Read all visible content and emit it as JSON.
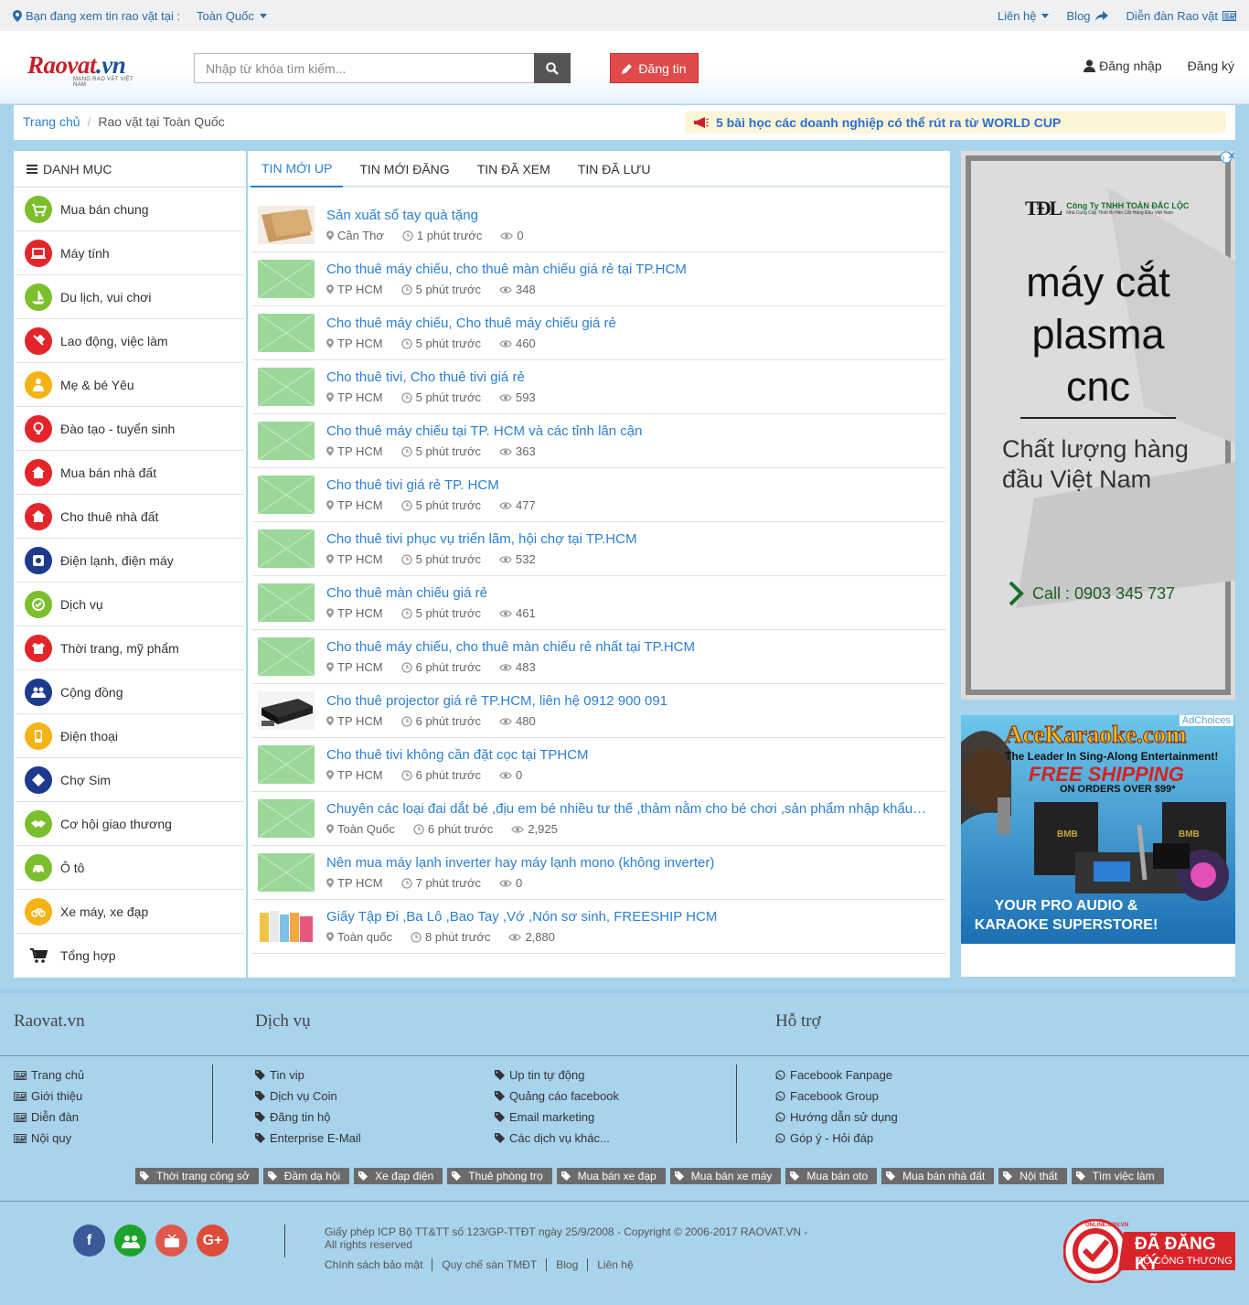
{
  "topbar": {
    "viewing_label": "Bạn đang xem tin rao vặt tại :",
    "region": "Toàn Quốc",
    "links": [
      "Liên hệ",
      "Blog",
      "Diễn đàn Rao vặt"
    ]
  },
  "header": {
    "logo_text": "Raovat",
    "logo_domain": ".vn",
    "logo_tagline": "MẠNG RAO VẶT VIỆT NAM",
    "search_placeholder": "Nhập từ khóa tìm kiếm...",
    "post_button": "Đăng tin",
    "login": "Đăng nhập",
    "register": "Đăng ký"
  },
  "breadcrumb": {
    "home": "Trang chủ",
    "current": "Rao vặt tại Toàn Quốc",
    "announcement": "5 bài học các doanh nghiệp có thể rút ra từ WORLD CUP"
  },
  "sidebar": {
    "title": "DANH MỤC",
    "items": [
      {
        "label": "Mua bán chung",
        "icon": "cart-icon",
        "color": "#7cbf2c"
      },
      {
        "label": "Máy tính",
        "icon": "laptop-icon",
        "color": "#e3252b"
      },
      {
        "label": "Du lịch, vui chơi",
        "icon": "sailboat-icon",
        "color": "#7cbf2c"
      },
      {
        "label": "Lao động, việc làm",
        "icon": "tools-icon",
        "color": "#e3252b"
      },
      {
        "label": "Mẹ & bé Yêu",
        "icon": "baby-icon",
        "color": "#f5b316"
      },
      {
        "label": "Đào tạo - tuyển sinh",
        "icon": "lightbulb-icon",
        "color": "#e3252b"
      },
      {
        "label": "Mua bán nhà đất",
        "icon": "house-icon",
        "color": "#e3252b"
      },
      {
        "label": "Cho thuê nhà đất",
        "icon": "house-icon",
        "color": "#e3252b"
      },
      {
        "label": "Điện lạnh, điện máy",
        "icon": "washer-icon",
        "color": "#1e3a8f"
      },
      {
        "label": "Dịch vụ",
        "icon": "service-icon",
        "color": "#7cbf2c"
      },
      {
        "label": "Thời trang, mỹ phẩm",
        "icon": "shirt-icon",
        "color": "#e3252b"
      },
      {
        "label": "Cộng đồng",
        "icon": "people-icon",
        "color": "#1e3a8f"
      },
      {
        "label": "Điện thoại",
        "icon": "phone-icon",
        "color": "#f5b316"
      },
      {
        "label": "Chợ Sim",
        "icon": "sim-icon",
        "color": "#1e3a8f"
      },
      {
        "label": "Cơ hội giao thương",
        "icon": "handshake-icon",
        "color": "#7cbf2c"
      },
      {
        "label": "Ô tô",
        "icon": "car-icon",
        "color": "#7cbf2c"
      },
      {
        "label": "Xe máy, xe đạp",
        "icon": "bicycle-icon",
        "color": "#f5b316"
      },
      {
        "label": "Tổng hợp",
        "icon": "shopping-cart-icon",
        "color": "#222222"
      }
    ]
  },
  "tabs": [
    "TIN MỚI UP",
    "TIN MỚI ĐĂNG",
    "TIN ĐÃ XEM",
    "TIN ĐÃ LƯU"
  ],
  "listings": [
    {
      "title": "Sản xuất sổ tay quà tặng",
      "location": "Cần Thơ",
      "time": "1 phút trước",
      "views": "0",
      "thumb": "notebook"
    },
    {
      "title": "Cho thuê máy chiếu, cho thuê màn chiếu giá rẻ tại TP.HCM",
      "location": "TP HCM",
      "time": "5 phút trước",
      "views": "348",
      "thumb": "placeholder"
    },
    {
      "title": "Cho thuê máy chiếu, Cho thuê máy chiếu giá rẻ",
      "location": "TP HCM",
      "time": "5 phút trước",
      "views": "460",
      "thumb": "placeholder"
    },
    {
      "title": "Cho thuê tivi, Cho thuê tivi giá rẻ",
      "location": "TP HCM",
      "time": "5 phút trước",
      "views": "593",
      "thumb": "placeholder"
    },
    {
      "title": "Cho thuê máy chiếu tại TP. HCM và các tỉnh lân cận",
      "location": "TP HCM",
      "time": "5 phút trước",
      "views": "363",
      "thumb": "placeholder"
    },
    {
      "title": "Cho thuê tivi giá rẻ TP. HCM",
      "location": "TP HCM",
      "time": "5 phút trước",
      "views": "477",
      "thumb": "placeholder"
    },
    {
      "title": "Cho thuê tivi phục vụ triển lãm, hội chợ tại TP.HCM",
      "location": "TP HCM",
      "time": "5 phút trước",
      "views": "532",
      "thumb": "placeholder"
    },
    {
      "title": "Cho thuê màn chiếu giá rẻ",
      "location": "TP HCM",
      "time": "5 phút trước",
      "views": "461",
      "thumb": "placeholder"
    },
    {
      "title": "Cho thuê máy chiếu, cho thuê màn chiếu rẻ nhất tại TP.HCM",
      "location": "TP HCM",
      "time": "6 phút trước",
      "views": "483",
      "thumb": "placeholder"
    },
    {
      "title": "Cho thuê projector giá rẻ TP.HCM, liên hệ 0912 900 091",
      "location": "TP HCM",
      "time": "6 phút trước",
      "views": "480",
      "thumb": "projector"
    },
    {
      "title": "Cho thuê tivi không cần đặt cọc tại TPHCM",
      "location": "TP HCM",
      "time": "6 phút trước",
      "views": "0",
      "thumb": "placeholder"
    },
    {
      "title": "Chuyên các loại đai dắt bé ,địu em bé nhiều tư thế ,thảm nằm cho bé chơi ,sản phẩm nhập khẩu giá tốt",
      "location": "Toàn Quốc",
      "time": "6 phút trước",
      "views": "2,925",
      "thumb": "placeholder"
    },
    {
      "title": "Nên mua máy lạnh inverter hay máy lạnh mono (không inverter)",
      "location": "TP HCM",
      "time": "7 phút trước",
      "views": "0",
      "thumb": "placeholder"
    },
    {
      "title": "Giấy Tập Đi ,Ba Lô ,Bao Tay ,Vớ ,Nón sơ sinh, FREESHIP HCM",
      "location": "Toàn quốc",
      "time": "8 phút trước",
      "views": "2,880",
      "thumb": "products"
    }
  ],
  "ad1": {
    "company": "Công Ty TNHH TOÀN ĐẮC LỘC",
    "company_sub": "Nhà Cung Cấp Thiết Bị Hàn Cắt Hàng Đầu Việt Nam",
    "brand": "TĐL",
    "line1": "máy cắt",
    "line2": "plasma",
    "line3": "cnc",
    "tagline1": "Chất lượng hàng",
    "tagline2": "đầu Việt Nam",
    "call": "Call : 0903 345 737"
  },
  "ad2": {
    "adchoices": "AdChoices",
    "brand": "AceKaraoke.com",
    "leader": "The Leader In Sing-Along Entertainment!",
    "shipping": "FREE SHIPPING",
    "orders": "ON ORDERS OVER $99*",
    "speaker_brand": "BMB",
    "footer1": "YOUR PRO AUDIO &",
    "footer2": "KARAOKE SUPERSTORE!"
  },
  "footer": {
    "col1_title": "Raovat.vn",
    "col2_title": "Dịch vụ",
    "col3_title": "Hỗ trợ",
    "col1_links": [
      "Trang chủ",
      "Giới thiệu",
      "Diễn đàn",
      "Nội quy"
    ],
    "col2a_links": [
      "Tin vip",
      "Dịch vụ Coin",
      "Đăng tin hộ",
      "Enterprise E-Mail"
    ],
    "col2b_links": [
      "Up tin tự động",
      "Quảng cáo facebook",
      "Email marketing",
      "Các dịch vụ khác..."
    ],
    "col3_links": [
      "Facebook Fanpage",
      "Facebook Group",
      "Hướng dẫn sử dụng",
      "Góp ý - Hỏi đáp"
    ],
    "tags": [
      "Thời trang công sở",
      "Đầm dạ hội",
      "Xe đạp điện",
      "Thuê phòng trọ",
      "Mua bán xe đạp",
      "Mua bán xe máy",
      "Mua bán oto",
      "Mua bán nhà đất",
      "Nội thất",
      "Tìm việc làm"
    ],
    "social": [
      {
        "name": "facebook-icon",
        "glyph": "f",
        "color": "#3b5998"
      },
      {
        "name": "group-icon",
        "glyph": "",
        "color": "#1da32b"
      },
      {
        "name": "youtube-icon",
        "glyph": "",
        "color": "#e0584d"
      },
      {
        "name": "google-plus-icon",
        "glyph": "G+",
        "color": "#dd4b39"
      }
    ],
    "copyright": "Giấy phép ICP Bộ TT&TT số 123/GP-TTĐT ngày 25/9/2008 - Copyright © 2006-2017 RAOVAT.VN - All rights reserved",
    "bottom_links": [
      "Chính sách bảo mật",
      "Quy chế sàn TMĐT",
      "Blog",
      "Liên hệ"
    ],
    "badge_title": "ĐÃ ĐĂNG KÝ",
    "badge_sub": "BỘ CÔNG THƯƠNG",
    "badge_ring": "ONLINE.GOV.VN"
  }
}
